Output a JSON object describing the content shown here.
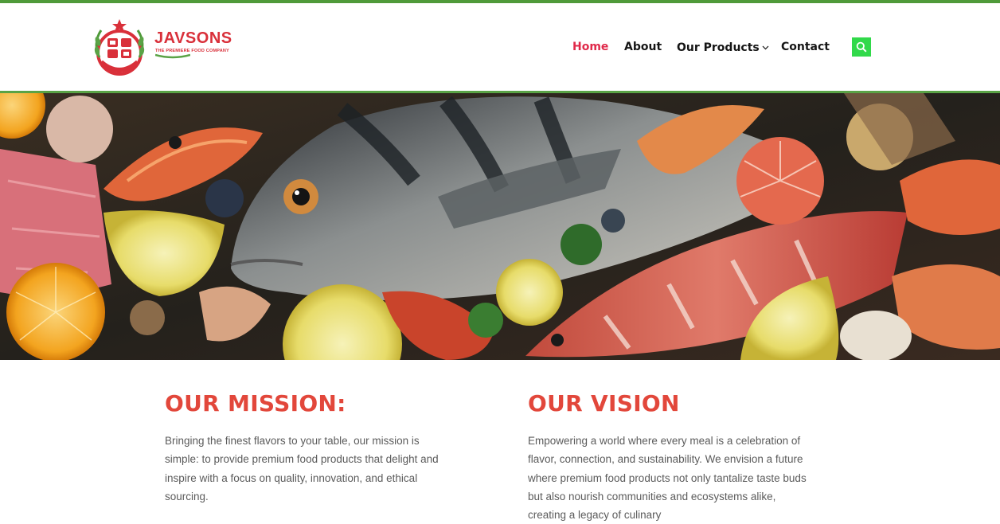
{
  "brand": {
    "name": "JAVSONS",
    "tagline": "THE PREMIERE FOOD COMPANY"
  },
  "nav": {
    "items": [
      {
        "label": "Home",
        "active": true
      },
      {
        "label": "About",
        "active": false
      },
      {
        "label": "Our Products",
        "active": false,
        "has_dropdown": true
      },
      {
        "label": "Contact",
        "active": false
      }
    ],
    "search_icon": "search-icon"
  },
  "hero": {
    "image": "seafood platter with fish, prawns, shellfish, lemons and oranges"
  },
  "mission": {
    "title": "OUR MISSION:",
    "text": "Bringing the finest flavors to your table, our mission is simple: to provide premium food products that delight and inspire with a focus on quality, innovation, and ethical sourcing."
  },
  "vision": {
    "title": "OUR VISION",
    "text": "Empowering a world where every meal is a celebration of flavor, connection, and sustainability. We envision a future where premium food products not only tantalize taste buds but also nourish communities and ecosystems alike, creating a legacy of culinary"
  },
  "colors": {
    "brand_red": "#d9303a",
    "accent_green": "#5aa346",
    "search_green": "#31d94a",
    "nav_active": "#e0294a",
    "heading_red": "#e2473b"
  }
}
